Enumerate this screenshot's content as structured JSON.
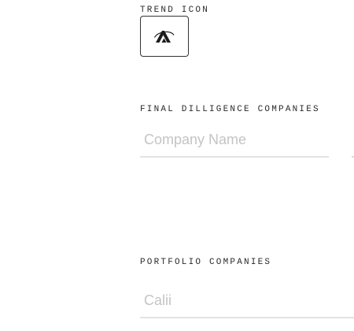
{
  "trend_icon": {
    "label": "TREND ICON",
    "icon": "trend-logo-icon"
  },
  "final_diligence": {
    "label": "FINAL DILLIGENCE COMPANIES",
    "placeholder": "Company Name",
    "value": ""
  },
  "portfolio": {
    "label": "PORTFOLIO COMPANIES",
    "value": "Calii"
  }
}
